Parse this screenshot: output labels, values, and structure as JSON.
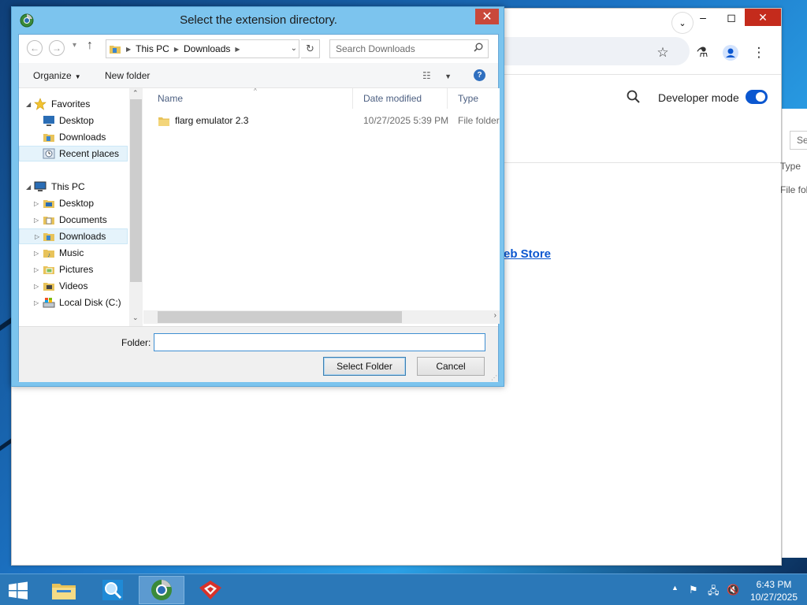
{
  "dialog": {
    "title": "Select the extension directory.",
    "close_glyph": "✕",
    "nav": {
      "back_glyph": "←",
      "forward_glyph": "→",
      "up_glyph": "↑",
      "breadcrumbs": [
        "This PC",
        "Downloads"
      ],
      "refresh_glyph": "↻",
      "search_placeholder": "Search Downloads"
    },
    "toolbar": {
      "organize_label": "Organize",
      "new_folder_label": "New folder",
      "help_glyph": "?"
    },
    "tree": {
      "favorites": "Favorites",
      "favorites_items": [
        "Desktop",
        "Downloads",
        "Recent places"
      ],
      "this_pc": "This PC",
      "this_pc_items": [
        "Desktop",
        "Documents",
        "Downloads",
        "Music",
        "Pictures",
        "Videos",
        "Local Disk (C:)"
      ]
    },
    "columns": {
      "name": "Name",
      "date_modified": "Date modified",
      "type": "Type"
    },
    "files": [
      {
        "name": "flarg emulator 2.3",
        "date_modified": "10/27/2025 5:39 PM",
        "type": "File folder"
      }
    ],
    "folder_label": "Folder:",
    "folder_value": "",
    "select_button": "Select Folder",
    "cancel_button": "Cancel"
  },
  "browser": {
    "developer_mode_label": "Developer mode",
    "developer_mode_on": true,
    "webstore_link_fragment": "eb Store",
    "bg_search_fragment": "Sea",
    "bg_type_fragment": "Type",
    "bg_file_fragment": "File fol"
  },
  "taskbar": {
    "time": "6:43 PM",
    "date": "10/27/2025"
  },
  "colors": {
    "dialog_frame": "#7cc4ee",
    "accent": "#0b57d0",
    "taskbar": "#2b78b8",
    "close_red": "#c9483a"
  }
}
